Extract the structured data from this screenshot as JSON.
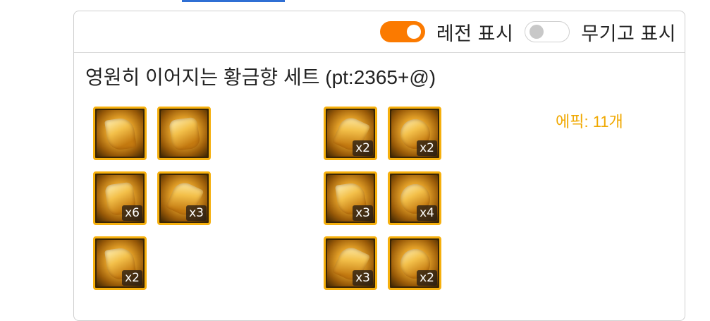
{
  "header": {
    "legend_toggle": {
      "label": "레전 표시",
      "on": true
    },
    "weapon_toggle": {
      "label": "무기고 표시",
      "on": false
    },
    "accent_color": "#fb7a00"
  },
  "set": {
    "title": "영원히 이어지는 황금향 세트 (pt:2365+@)",
    "epic_count": "에픽: 11개",
    "epic_color": "#f0a800",
    "armor_items": [
      {
        "icon": "golden-shoulder-icon",
        "count": ""
      },
      {
        "icon": "golden-top-armor-icon",
        "count": ""
      },
      {
        "icon": "golden-bottom-armor-icon",
        "count": "x6"
      },
      {
        "icon": "golden-belt-icon",
        "count": "x3"
      },
      {
        "icon": "golden-shoes-icon",
        "count": "x2"
      }
    ],
    "accessory_items": [
      {
        "icon": "golden-bracelet-icon",
        "count": "x2"
      },
      {
        "icon": "golden-necklace-icon",
        "count": "x2"
      },
      {
        "icon": "golden-ring-icon",
        "count": "x3"
      },
      {
        "icon": "golden-support-icon",
        "count": "x4"
      },
      {
        "icon": "golden-magic-stone-icon",
        "count": "x3"
      },
      {
        "icon": "golden-earring-icon",
        "count": "x2"
      }
    ]
  }
}
